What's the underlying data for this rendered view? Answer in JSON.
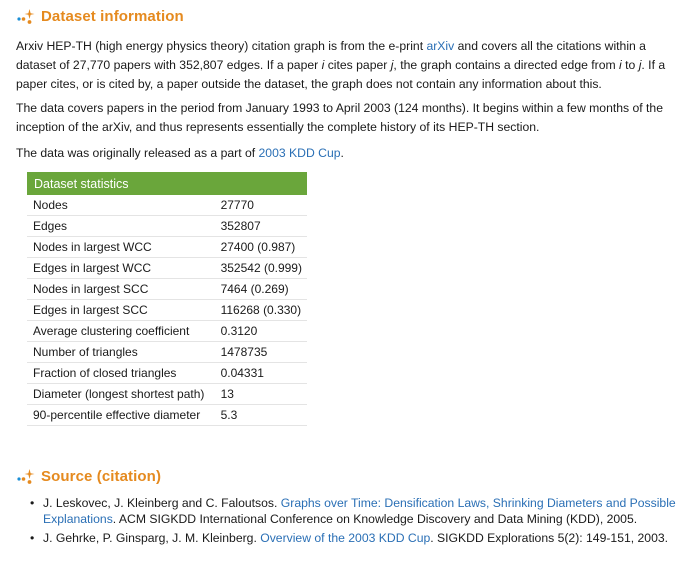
{
  "dataset_info": {
    "heading": "Dataset information",
    "p1": {
      "t1": "Arxiv HEP-TH (high energy physics theory) citation graph is from the e-print ",
      "link": "arXiv",
      "t2": " and covers all the citations within a dataset of 27,770 papers with 352,807 edges. If a paper ",
      "i1": "i",
      "t3": " cites paper ",
      "j1": "j",
      "t4": ", the graph contains a directed edge from ",
      "i2": "i",
      "t5": " to ",
      "j2": "j",
      "t6": ". If a paper cites, or is cited by, a paper outside the dataset, the graph does not contain any information about this."
    },
    "p2": "The data covers papers in the period from January 1993 to April 2003 (124 months). It begins within a few months of the inception of the arXiv, and thus represents essentially the complete history of its HEP-TH section.",
    "p3": {
      "t1": "The data was originally released as a part of ",
      "link": "2003 KDD Cup",
      "t2": "."
    }
  },
  "stats": {
    "header": "Dataset statistics",
    "rows": [
      {
        "label": "Nodes",
        "value": "27770"
      },
      {
        "label": "Edges",
        "value": "352807"
      },
      {
        "label": "Nodes in largest WCC",
        "value": "27400 (0.987)"
      },
      {
        "label": "Edges in largest WCC",
        "value": "352542 (0.999)"
      },
      {
        "label": "Nodes in largest SCC",
        "value": "7464 (0.269)"
      },
      {
        "label": "Edges in largest SCC",
        "value": "116268 (0.330)"
      },
      {
        "label": "Average clustering coefficient",
        "value": "0.3120"
      },
      {
        "label": "Number of triangles",
        "value": "1478735"
      },
      {
        "label": "Fraction of closed triangles",
        "value": "0.04331"
      },
      {
        "label": "Diameter (longest shortest path)",
        "value": "13"
      },
      {
        "label": "90-percentile effective diameter",
        "value": "5.3"
      }
    ]
  },
  "source": {
    "heading": "Source (citation)",
    "refs": [
      {
        "bullet": "•",
        "authors": "J. Leskovec, J. Kleinberg and C. Faloutsos. ",
        "link": "Graphs over Time: Densification Laws, Shrinking Diameters and Possible Explanations",
        "rest": ". ACM SIGKDD International Conference on Knowledge Discovery and Data Mining (KDD), 2005."
      },
      {
        "bullet": "•",
        "authors": "J. Gehrke, P. Ginsparg, J. M. Kleinberg. ",
        "link": "Overview of the 2003 KDD Cup",
        "rest": ". SIGKDD Explorations 5(2): 149-151, 2003."
      }
    ]
  },
  "colors": {
    "heading": "#e58a1f",
    "link": "#2a6fb5",
    "table_header": "#6aa63b",
    "icon_dot": "#1b8fd6"
  },
  "icons": {
    "heading_icon": "orange-sparkle-dots-icon"
  }
}
